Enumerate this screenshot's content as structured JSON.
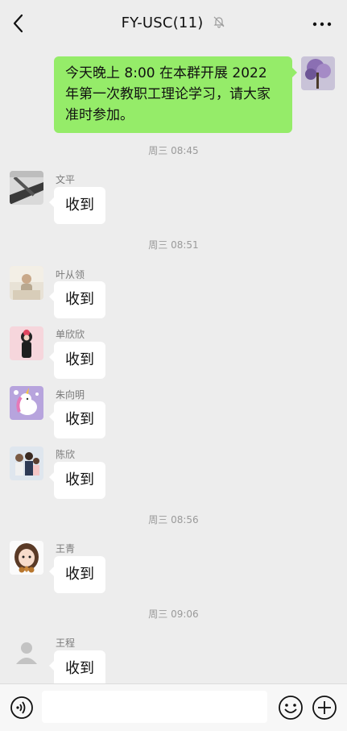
{
  "header": {
    "title": "FY-USC(11)",
    "back_icon": "back-chevron-icon",
    "mute_icon": "bell-muted-icon",
    "more_icon": "more-dots-icon"
  },
  "messages": {
    "self": {
      "text": "今天晚上 8:00 在本群开展 2022 年第一次教职工理论学习，请大家准时参加。"
    },
    "times": [
      "周三 08:45",
      "周三 08:51",
      "周三 08:56",
      "周三 09:06"
    ],
    "group": [
      {
        "sender": "文平",
        "text": "收到"
      },
      {
        "sender": "叶从领",
        "text": "收到"
      },
      {
        "sender": "单欣欣",
        "text": "收到"
      },
      {
        "sender": "朱向明",
        "text": "收到"
      },
      {
        "sender": "陈欣",
        "text": "收到"
      },
      {
        "sender": "王青",
        "text": "收到"
      },
      {
        "sender": "王程",
        "text": "收到"
      }
    ]
  },
  "composer": {
    "voice_icon": "voice-icon",
    "input_value": "",
    "emoji_icon": "emoji-icon",
    "plus_icon": "plus-icon"
  },
  "colors": {
    "background": "#ededed",
    "self_bubble": "#95ec69",
    "other_bubble": "#ffffff"
  }
}
